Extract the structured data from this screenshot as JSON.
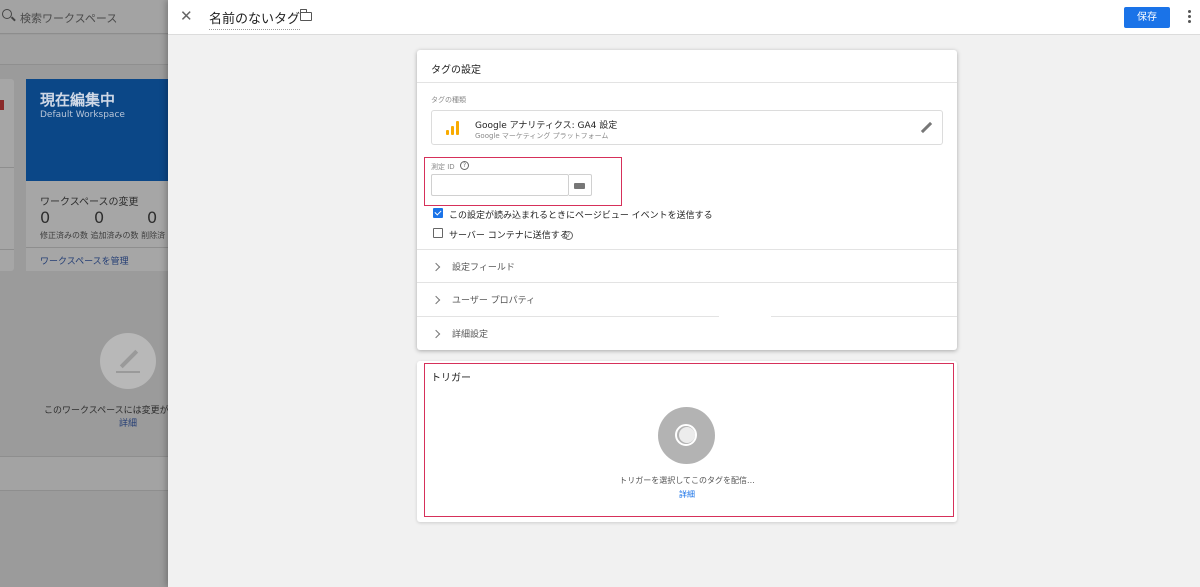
{
  "background": {
    "search_placeholder": "検索ワークスペース",
    "current_editing": "現在編集中",
    "workspace_name": "Default Workspace",
    "workspace_changes_heading": "ワークスペースの変更",
    "counts": [
      "0",
      "0",
      "0"
    ],
    "count_labels": "修正済みの数 追加済みの数 削除済",
    "manage_link": "ワークスペースを管理",
    "empty_message": "このワークスペースには変更がま",
    "detail_link": "詳細"
  },
  "header": {
    "tag_name": "名前のないタグ",
    "save_label": "保存"
  },
  "tag_config": {
    "title": "タグの設定",
    "type_label": "タグの種類",
    "type_name": "Google アナリティクス: GA4 設定",
    "type_sub": "Google マーケティング プラットフォーム",
    "measurement_id_label": "測定 ID",
    "measurement_id_value": "",
    "send_pageview_label": "この設定が読み込まれるときにページビュー イベントを送信する",
    "send_pageview_checked": true,
    "server_container_label": "サーバー コンテナに送信する",
    "server_container_checked": false,
    "sections": [
      "設定フィールド",
      "ユーザー プロパティ",
      "詳細設定"
    ]
  },
  "trigger": {
    "title": "トリガー",
    "message": "トリガーを選択してこのタグを配信...",
    "detail_link": "詳細"
  },
  "colors": {
    "accent": "#1a73e8",
    "highlight": "#d6305a",
    "workspace_blue": "#0b4787",
    "ga_orange": "#f9ab00"
  }
}
